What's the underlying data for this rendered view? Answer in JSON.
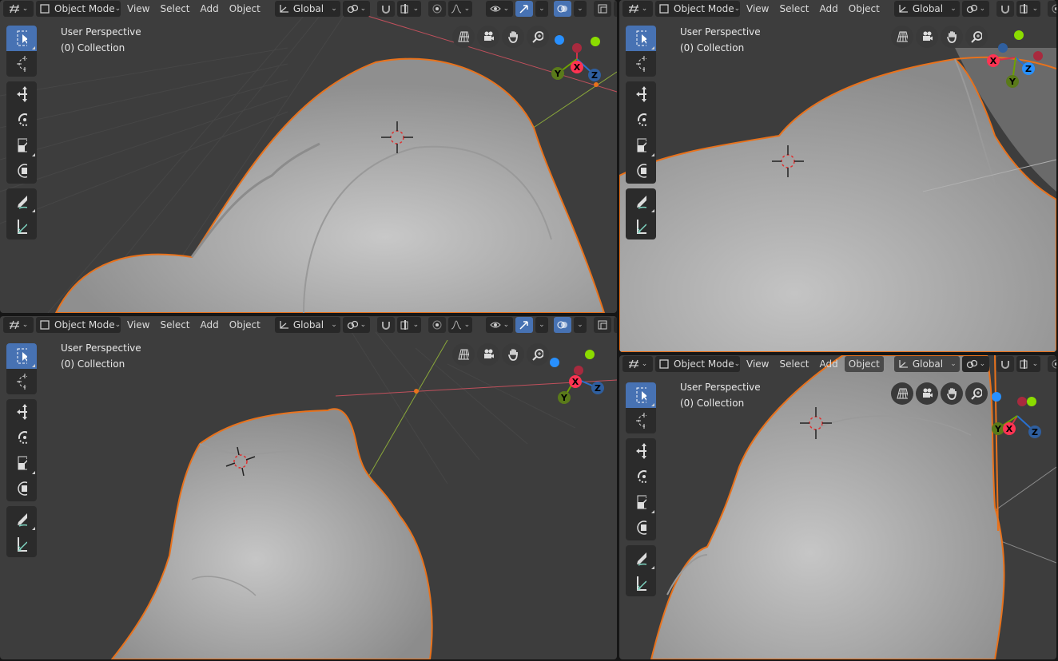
{
  "header": {
    "mode_label": "Object Mode",
    "menu": [
      "View",
      "Select",
      "Add",
      "Object"
    ],
    "orientation_label": "Global"
  },
  "viewports": [
    {
      "id": "top-left",
      "info_line1": "User Perspective",
      "info_line2": "(0) Collection"
    },
    {
      "id": "top-right",
      "info_line1": "User Perspective",
      "info_line2": "(0) Collection"
    },
    {
      "id": "bottom-left",
      "info_line1": "User Perspective",
      "info_line2": "(0) Collection"
    },
    {
      "id": "bottom-right",
      "info_line1": "User Perspective",
      "info_line2": "(0) Collection"
    }
  ],
  "gizmo_labels": {
    "x": "X",
    "y": "Y",
    "z": "Z"
  },
  "tools": [
    "select-box-tool",
    "cursor-tool",
    "move-tool",
    "rotate-tool",
    "scale-tool",
    "transform-tool",
    "annotate-tool",
    "measure-tool"
  ],
  "nav_icons": [
    "perspective-grid-icon",
    "camera-icon",
    "hand-pan-icon",
    "zoom-icon"
  ],
  "colors": {
    "viewport_bg": "#3d3d3d",
    "mesh": "#a9a9a9",
    "outline": "#e8721c",
    "tool_active": "#4772b3",
    "axis_x": "#ff3352",
    "axis_y": "#8bdc00",
    "axis_z": "#2890ff"
  }
}
